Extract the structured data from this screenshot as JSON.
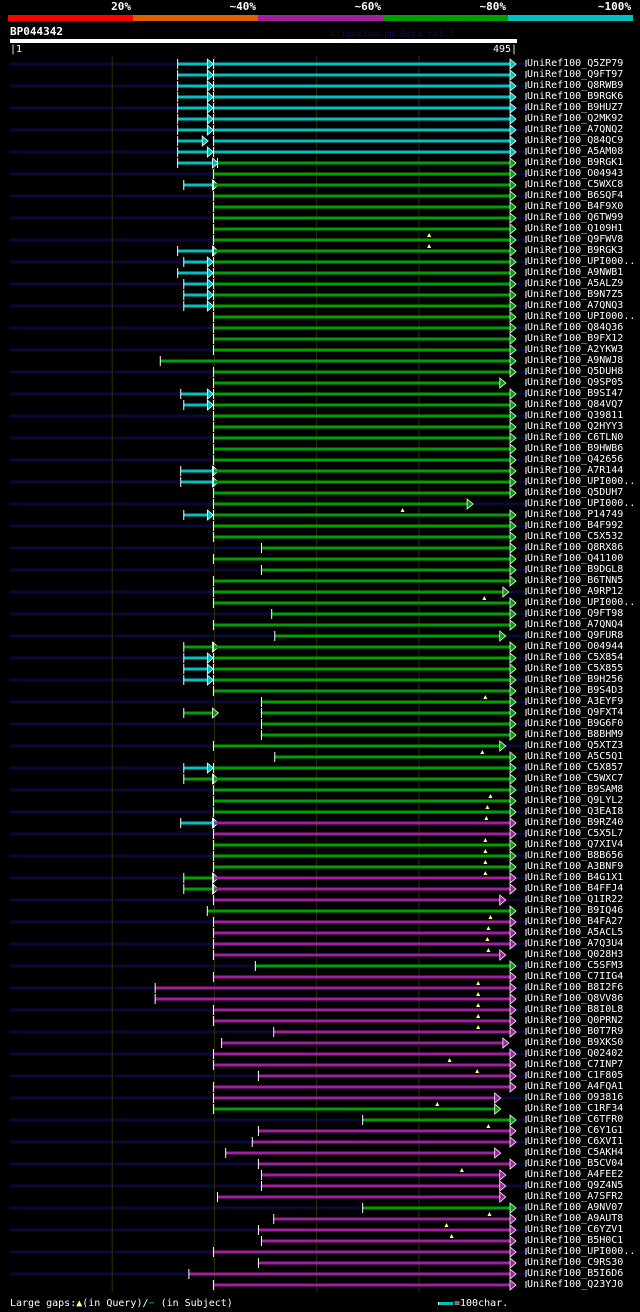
{
  "color_key": [
    {
      "label": "20%",
      "color": "#ff0000"
    },
    {
      "label": "~40%",
      "color": "#e06000"
    },
    {
      "label": "~60%",
      "color": "#a020a0"
    },
    {
      "label": "~80%",
      "color": "#00a000"
    },
    {
      "label": "~100%",
      "color": "#00c0c0"
    }
  ],
  "hit_colors": {
    "c": "#00c0c0",
    "g": "#00a000",
    "m": "#a020a0"
  },
  "query": {
    "name": "BP044342",
    "start_label": "|1",
    "end_label": "495|",
    "length": 495
  },
  "watermark": "AlignView.pm Beta rel.7",
  "footer": {
    "gaps_label": "Large gaps:",
    "in_query": "(in Query)/",
    "in_subject": "(in Subject)",
    "triangle_glyph": "▲",
    "dash_glyph": "−",
    "scale_label": "=100char."
  },
  "hits": [
    {
      "id": "UniRef100_Q5ZP79",
      "color": "c",
      "start": 200,
      "end": 495,
      "left": {
        "color": "c",
        "start": 165,
        "end": 195
      }
    },
    {
      "id": "UniRef100_Q9FT97",
      "color": "c",
      "start": 200,
      "end": 495,
      "left": {
        "color": "c",
        "start": 165,
        "end": 195
      }
    },
    {
      "id": "UniRef100_Q8RWB9",
      "color": "c",
      "start": 200,
      "end": 495,
      "left": {
        "color": "c",
        "start": 165,
        "end": 195
      }
    },
    {
      "id": "UniRef100_B9RGK6",
      "color": "c",
      "start": 200,
      "end": 495,
      "left": {
        "color": "c",
        "start": 165,
        "end": 195
      }
    },
    {
      "id": "UniRef100_B9HUZ7",
      "color": "c",
      "start": 200,
      "end": 495,
      "left": {
        "color": "c",
        "start": 165,
        "end": 195
      }
    },
    {
      "id": "UniRef100_Q2MK92",
      "color": "c",
      "start": 200,
      "end": 495,
      "left": {
        "color": "c",
        "start": 165,
        "end": 195
      }
    },
    {
      "id": "UniRef100_A7QNQ2",
      "color": "c",
      "start": 200,
      "end": 495,
      "left": {
        "color": "c",
        "start": 165,
        "end": 195
      }
    },
    {
      "id": "UniRef100_Q84QC9",
      "color": "c",
      "start": 200,
      "end": 495,
      "left": {
        "color": "c",
        "start": 165,
        "end": 190
      }
    },
    {
      "id": "UniRef100_A5AM08",
      "color": "c",
      "start": 200,
      "end": 495,
      "left": {
        "color": "c",
        "start": 165,
        "end": 195
      }
    },
    {
      "id": "UniRef100_B9RGK1",
      "color": "g",
      "start": 204,
      "end": 495,
      "left": {
        "color": "c",
        "start": 165,
        "end": 200
      }
    },
    {
      "id": "UniRef100_O04943",
      "color": "g",
      "start": 200,
      "end": 495
    },
    {
      "id": "UniRef100_C5WXC8",
      "color": "g",
      "start": 200,
      "end": 495,
      "left": {
        "color": "c",
        "start": 171,
        "end": 200
      }
    },
    {
      "id": "UniRef100_B6SQF4",
      "color": "g",
      "start": 200,
      "end": 495
    },
    {
      "id": "UniRef100_B4F9X0",
      "color": "g",
      "start": 200,
      "end": 495
    },
    {
      "id": "UniRef100_Q6TW99",
      "color": "g",
      "start": 200,
      "end": 495
    },
    {
      "id": "UniRef100_Q109H1",
      "color": "g",
      "start": 200,
      "end": 495,
      "gap": 411
    },
    {
      "id": "UniRef100_Q9FWV8",
      "color": "g",
      "start": 200,
      "end": 495,
      "gap": 411
    },
    {
      "id": "UniRef100_B9RGK3",
      "color": "g",
      "start": 200,
      "end": 495,
      "left": {
        "color": "c",
        "start": 165,
        "end": 200
      }
    },
    {
      "id": "UniRef100_UPI000..",
      "color": "g",
      "start": 200,
      "end": 495,
      "left": {
        "color": "c",
        "start": 171,
        "end": 195
      }
    },
    {
      "id": "UniRef100_A9NWB1",
      "color": "g",
      "start": 200,
      "end": 495,
      "left": {
        "color": "c",
        "start": 165,
        "end": 195
      }
    },
    {
      "id": "UniRef100_A5ALZ9",
      "color": "g",
      "start": 200,
      "end": 495,
      "left": {
        "color": "c",
        "start": 171,
        "end": 195
      }
    },
    {
      "id": "UniRef100_B9N7Z5",
      "color": "g",
      "start": 200,
      "end": 495,
      "left": {
        "color": "c",
        "start": 171,
        "end": 195
      }
    },
    {
      "id": "UniRef100_A7QNQ3",
      "color": "g",
      "start": 200,
      "end": 495,
      "left": {
        "color": "c",
        "start": 171,
        "end": 195
      }
    },
    {
      "id": "UniRef100_UPI000..",
      "color": "g",
      "start": 200,
      "end": 495
    },
    {
      "id": "UniRef100_Q84Q36",
      "color": "g",
      "start": 200,
      "end": 495
    },
    {
      "id": "UniRef100_B9FX12",
      "color": "g",
      "start": 200,
      "end": 495
    },
    {
      "id": "UniRef100_A2YKW3",
      "color": "g",
      "start": 200,
      "end": 495
    },
    {
      "id": "UniRef100_A9NWJ8",
      "color": "g",
      "start": 148,
      "end": 495
    },
    {
      "id": "UniRef100_Q5DUH8",
      "color": "g",
      "start": 200,
      "end": 495
    },
    {
      "id": "UniRef100_Q9SP05",
      "color": "g",
      "start": 200,
      "end": 485
    },
    {
      "id": "UniRef100_B9SI47",
      "color": "g",
      "start": 200,
      "end": 495,
      "left": {
        "color": "c",
        "start": 168,
        "end": 195
      }
    },
    {
      "id": "UniRef100_Q84VQ7",
      "color": "g",
      "start": 200,
      "end": 495,
      "left": {
        "color": "c",
        "start": 171,
        "end": 195
      }
    },
    {
      "id": "UniRef100_Q39811",
      "color": "g",
      "start": 200,
      "end": 495
    },
    {
      "id": "UniRef100_Q2HYY3",
      "color": "g",
      "start": 200,
      "end": 495
    },
    {
      "id": "UniRef100_C6TLN0",
      "color": "g",
      "start": 200,
      "end": 495
    },
    {
      "id": "UniRef100_B9HWB6",
      "color": "g",
      "start": 200,
      "end": 495
    },
    {
      "id": "UniRef100_Q42656",
      "color": "g",
      "start": 200,
      "end": 495
    },
    {
      "id": "UniRef100_A7R144",
      "color": "g",
      "start": 200,
      "end": 495,
      "left": {
        "color": "c",
        "start": 168,
        "end": 200
      }
    },
    {
      "id": "UniRef100_UPI000..",
      "color": "g",
      "start": 200,
      "end": 495,
      "left": {
        "color": "c",
        "start": 168,
        "end": 200
      }
    },
    {
      "id": "UniRef100_Q5DUH7",
      "color": "g",
      "start": 200,
      "end": 495
    },
    {
      "id": "UniRef100_UPI000..",
      "color": "g",
      "start": 200,
      "end": 453,
      "gap": 385
    },
    {
      "id": "UniRef100_P14749",
      "color": "g",
      "start": 200,
      "end": 495,
      "left": {
        "color": "c",
        "start": 171,
        "end": 195
      }
    },
    {
      "id": "UniRef100_B4F992",
      "color": "g",
      "start": 200,
      "end": 495
    },
    {
      "id": "UniRef100_C5X532",
      "color": "g",
      "start": 200,
      "end": 495
    },
    {
      "id": "UniRef100_Q8RX86",
      "color": "g",
      "start": 247,
      "end": 495
    },
    {
      "id": "UniRef100_Q41100",
      "color": "g",
      "start": 200,
      "end": 495
    },
    {
      "id": "UniRef100_B9DGL8",
      "color": "g",
      "start": 247,
      "end": 495
    },
    {
      "id": "UniRef100_B6TNN5",
      "color": "g",
      "start": 200,
      "end": 495
    },
    {
      "id": "UniRef100_A9RP12",
      "color": "g",
      "start": 200,
      "end": 488,
      "gap": 465
    },
    {
      "id": "UniRef100_UPI000..",
      "color": "g",
      "start": 200,
      "end": 495
    },
    {
      "id": "UniRef100_Q9FT98",
      "color": "g",
      "start": 257,
      "end": 495
    },
    {
      "id": "UniRef100_A7QNQ4",
      "color": "g",
      "start": 200,
      "end": 495
    },
    {
      "id": "UniRef100_Q9FUR8",
      "color": "g",
      "start": 260,
      "end": 485
    },
    {
      "id": "UniRef100_O04944",
      "color": "g",
      "start": 200,
      "end": 495,
      "left": {
        "color": "g",
        "start": 171,
        "end": 200
      }
    },
    {
      "id": "UniRef100_C5X854",
      "color": "g",
      "start": 200,
      "end": 495,
      "left": {
        "color": "c",
        "start": 171,
        "end": 195
      }
    },
    {
      "id": "UniRef100_C5X855",
      "color": "g",
      "start": 200,
      "end": 495,
      "left": {
        "color": "c",
        "start": 171,
        "end": 195
      }
    },
    {
      "id": "UniRef100_B9H256",
      "color": "g",
      "start": 200,
      "end": 495,
      "left": {
        "color": "c",
        "start": 171,
        "end": 195
      }
    },
    {
      "id": "UniRef100_B9S4D3",
      "color": "g",
      "start": 200,
      "end": 495,
      "gap": 466
    },
    {
      "id": "UniRef100_A3EYF9",
      "color": "g",
      "start": 247,
      "end": 495
    },
    {
      "id": "UniRef100_Q9FXT4",
      "color": "g",
      "start": 247,
      "end": 495,
      "left": {
        "color": "g",
        "start": 171,
        "end": 200
      }
    },
    {
      "id": "UniRef100_B9G6F0",
      "color": "g",
      "start": 247,
      "end": 495
    },
    {
      "id": "UniRef100_B8BHM9",
      "color": "g",
      "start": 247,
      "end": 495
    },
    {
      "id": "UniRef100_Q5XTZ3",
      "color": "g",
      "start": 200,
      "end": 485,
      "gap": 463
    },
    {
      "id": "UniRef100_A5C5Q1",
      "color": "g",
      "start": 260,
      "end": 495
    },
    {
      "id": "UniRef100_C5X857",
      "color": "g",
      "start": 200,
      "end": 495,
      "left": {
        "color": "c",
        "start": 171,
        "end": 195
      }
    },
    {
      "id": "UniRef100_C5WXC7",
      "color": "g",
      "start": 200,
      "end": 495,
      "left": {
        "color": "g",
        "start": 171,
        "end": 200
      }
    },
    {
      "id": "UniRef100_B9SAM8",
      "color": "g",
      "start": 200,
      "end": 495,
      "gap": 471
    },
    {
      "id": "UniRef100_Q9LYL2",
      "color": "g",
      "start": 200,
      "end": 495,
      "gap": 468
    },
    {
      "id": "UniRef100_Q3EAI8",
      "color": "g",
      "start": 200,
      "end": 495,
      "gap": 467
    },
    {
      "id": "UniRef100_B9RZ40",
      "color": "m",
      "start": 200,
      "end": 495,
      "left": {
        "color": "c",
        "start": 168,
        "end": 200
      }
    },
    {
      "id": "UniRef100_C5X5L7",
      "color": "m",
      "start": 200,
      "end": 495,
      "gap": 466
    },
    {
      "id": "UniRef100_Q7XIV4",
      "color": "g",
      "start": 200,
      "end": 495,
      "gap": 466
    },
    {
      "id": "UniRef100_B8B656",
      "color": "g",
      "start": 200,
      "end": 495,
      "gap": 466
    },
    {
      "id": "UniRef100_A3BNF9",
      "color": "g",
      "start": 200,
      "end": 495,
      "gap": 466
    },
    {
      "id": "UniRef100_B4G1X1",
      "color": "m",
      "start": 200,
      "end": 495,
      "left": {
        "color": "g",
        "start": 171,
        "end": 200
      }
    },
    {
      "id": "UniRef100_B4FFJ4",
      "color": "m",
      "start": 200,
      "end": 495,
      "left": {
        "color": "g",
        "start": 171,
        "end": 200
      }
    },
    {
      "id": "UniRef100_Q1IR22",
      "color": "m",
      "start": 200,
      "end": 485
    },
    {
      "id": "UniRef100_B9IQ46",
      "color": "g",
      "start": 194,
      "end": 495,
      "gap": 471
    },
    {
      "id": "UniRef100_B4FA27",
      "color": "m",
      "start": 200,
      "end": 495,
      "gap": 469
    },
    {
      "id": "UniRef100_A5ACL5",
      "color": "m",
      "start": 200,
      "end": 495,
      "gap": 468
    },
    {
      "id": "UniRef100_A7Q3U4",
      "color": "m",
      "start": 200,
      "end": 495,
      "gap": 469
    },
    {
      "id": "UniRef100_Q028H3",
      "color": "m",
      "start": 200,
      "end": 485
    },
    {
      "id": "UniRef100_C5SFM3",
      "color": "g",
      "start": 241,
      "end": 495
    },
    {
      "id": "UniRef100_C7IIG4",
      "color": "m",
      "start": 200,
      "end": 495,
      "gap": 459
    },
    {
      "id": "UniRef100_B8I2F6",
      "color": "m",
      "start": 143,
      "end": 495,
      "gap": 459
    },
    {
      "id": "UniRef100_Q8VV86",
      "color": "m",
      "start": 143,
      "end": 495,
      "gap": 459
    },
    {
      "id": "UniRef100_B8I0L8",
      "color": "m",
      "start": 200,
      "end": 495,
      "gap": 459
    },
    {
      "id": "UniRef100_Q0PRN2",
      "color": "m",
      "start": 200,
      "end": 495,
      "gap": 459
    },
    {
      "id": "UniRef100_B0T7R9",
      "color": "m",
      "start": 259,
      "end": 495
    },
    {
      "id": "UniRef100_B9XKS0",
      "color": "m",
      "start": 208,
      "end": 488
    },
    {
      "id": "UniRef100_Q02402",
      "color": "m",
      "start": 200,
      "end": 495,
      "gap": 431
    },
    {
      "id": "UniRef100_C7INP7",
      "color": "m",
      "start": 200,
      "end": 495,
      "gap": 458
    },
    {
      "id": "UniRef100_C1F805",
      "color": "m",
      "start": 244,
      "end": 495
    },
    {
      "id": "UniRef100_A4FQA1",
      "color": "m",
      "start": 200,
      "end": 495
    },
    {
      "id": "UniRef100_O93816",
      "color": "m",
      "start": 200,
      "end": 480,
      "gap": 419
    },
    {
      "id": "UniRef100_C1RF34",
      "color": "g",
      "start": 200,
      "end": 480
    },
    {
      "id": "UniRef100_C6TFR0",
      "color": "g",
      "start": 346,
      "end": 495,
      "gap": 469
    },
    {
      "id": "UniRef100_C6Y1G1",
      "color": "m",
      "start": 244,
      "end": 495
    },
    {
      "id": "UniRef100_C6XVI1",
      "color": "m",
      "start": 238,
      "end": 495
    },
    {
      "id": "UniRef100_C5AKH4",
      "color": "m",
      "start": 212,
      "end": 480
    },
    {
      "id": "UniRef100_B5CV04",
      "color": "m",
      "start": 244,
      "end": 495,
      "gap": 443
    },
    {
      "id": "UniRef100_A4FEE2",
      "color": "m",
      "start": 247,
      "end": 485
    },
    {
      "id": "UniRef100_Q9Z4N5",
      "color": "m",
      "start": 247,
      "end": 485
    },
    {
      "id": "UniRef100_A7SFR2",
      "color": "m",
      "start": 204,
      "end": 485
    },
    {
      "id": "UniRef100_A9NV07",
      "color": "g",
      "start": 346,
      "end": 495,
      "gap": 470
    },
    {
      "id": "UniRef100_A9AUT8",
      "color": "m",
      "start": 259,
      "end": 495,
      "gap": 428
    },
    {
      "id": "UniRef100_C6YZV1",
      "color": "m",
      "start": 244,
      "end": 495,
      "gap": 433
    },
    {
      "id": "UniRef100_B5H0C1",
      "color": "m",
      "start": 247,
      "end": 495
    },
    {
      "id": "UniRef100_UPI000..",
      "color": "m",
      "start": 200,
      "end": 495
    },
    {
      "id": "UniRef100_C9RS30",
      "color": "m",
      "start": 244,
      "end": 495
    },
    {
      "id": "UniRef100_B5I6D6",
      "color": "m",
      "start": 176,
      "end": 495
    },
    {
      "id": "UniRef100_Q23YJ0",
      "color": "m",
      "start": 200,
      "end": 495
    }
  ]
}
